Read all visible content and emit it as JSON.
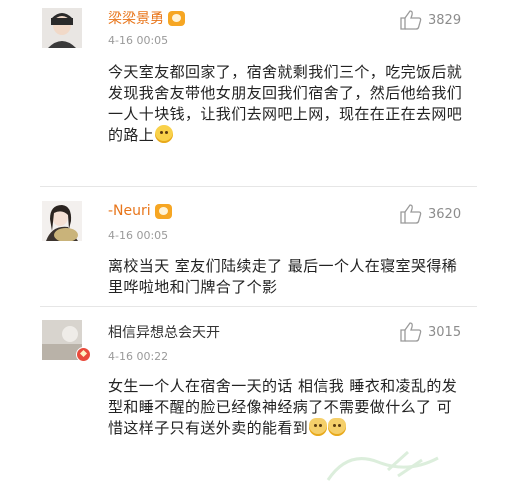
{
  "comments": [
    {
      "username": "梁梁景勇",
      "timestamp": "4-16 00:05",
      "like_count": "3829",
      "body": "今天室友都回家了，宿舍就剩我们三个，吃完饭后就发现我舍友带他女朋友回我们宿舍了，然后他给我们一人十块钱，让我们去网吧上网，现在在正在去网吧的路上",
      "name_color": "#e8751a",
      "badge": "vip-badge-icon",
      "trailing_emoji": "laughing-face-icon"
    },
    {
      "username": "-Neuri",
      "timestamp": "4-16 00:05",
      "like_count": "3620",
      "body": "离校当天 室友们陆续走了 最后一个人在寝室哭得稀里哗啦地和门牌合了个影",
      "name_color": "#e8751a",
      "badge": "vip-badge-icon"
    },
    {
      "username": "相信异想总会天开",
      "timestamp": "4-16 00:22",
      "like_count": "3015",
      "body": "女生一个人在宿舍一天的话 相信我 睡衣和凌乱的发型和睡不醒的脸已经像神经病了不需要做什么了 可惜这样子只有送外卖的能看到",
      "name_color": "#333333",
      "badge": "verified-badge-icon",
      "trailing_emoji": "cat-face-icon"
    }
  ],
  "colors": {
    "accent": "#e8751a",
    "muted": "#9a9a9a",
    "divider": "#e6e6e6"
  }
}
